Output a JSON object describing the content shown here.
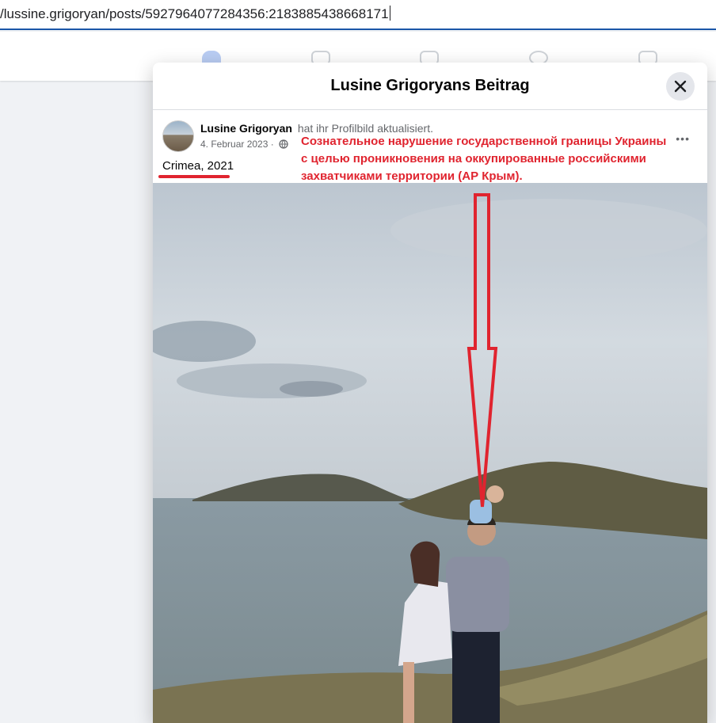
{
  "browser": {
    "url": "/lussine.grigoryan/posts/5927964077284356:2183885438668171"
  },
  "modal": {
    "title": "Lusine Grigoryans Beitrag",
    "close_icon": "close-icon"
  },
  "post": {
    "author_name": "Lusine Grigoryan",
    "action_text": "hat ihr Profilbild aktualisiert.",
    "date": "4. Februar 2023 ·",
    "privacy_icon": "globe-icon",
    "caption": "Crimea, 2021",
    "more_label": "•••"
  },
  "annotation": {
    "color": "#e0242f",
    "lines": [
      "Сознательное нарушение государственной границы Украины",
      "с целью проникновения на оккупированные российскими",
      "захватчиками территории (АР Крым)."
    ]
  }
}
